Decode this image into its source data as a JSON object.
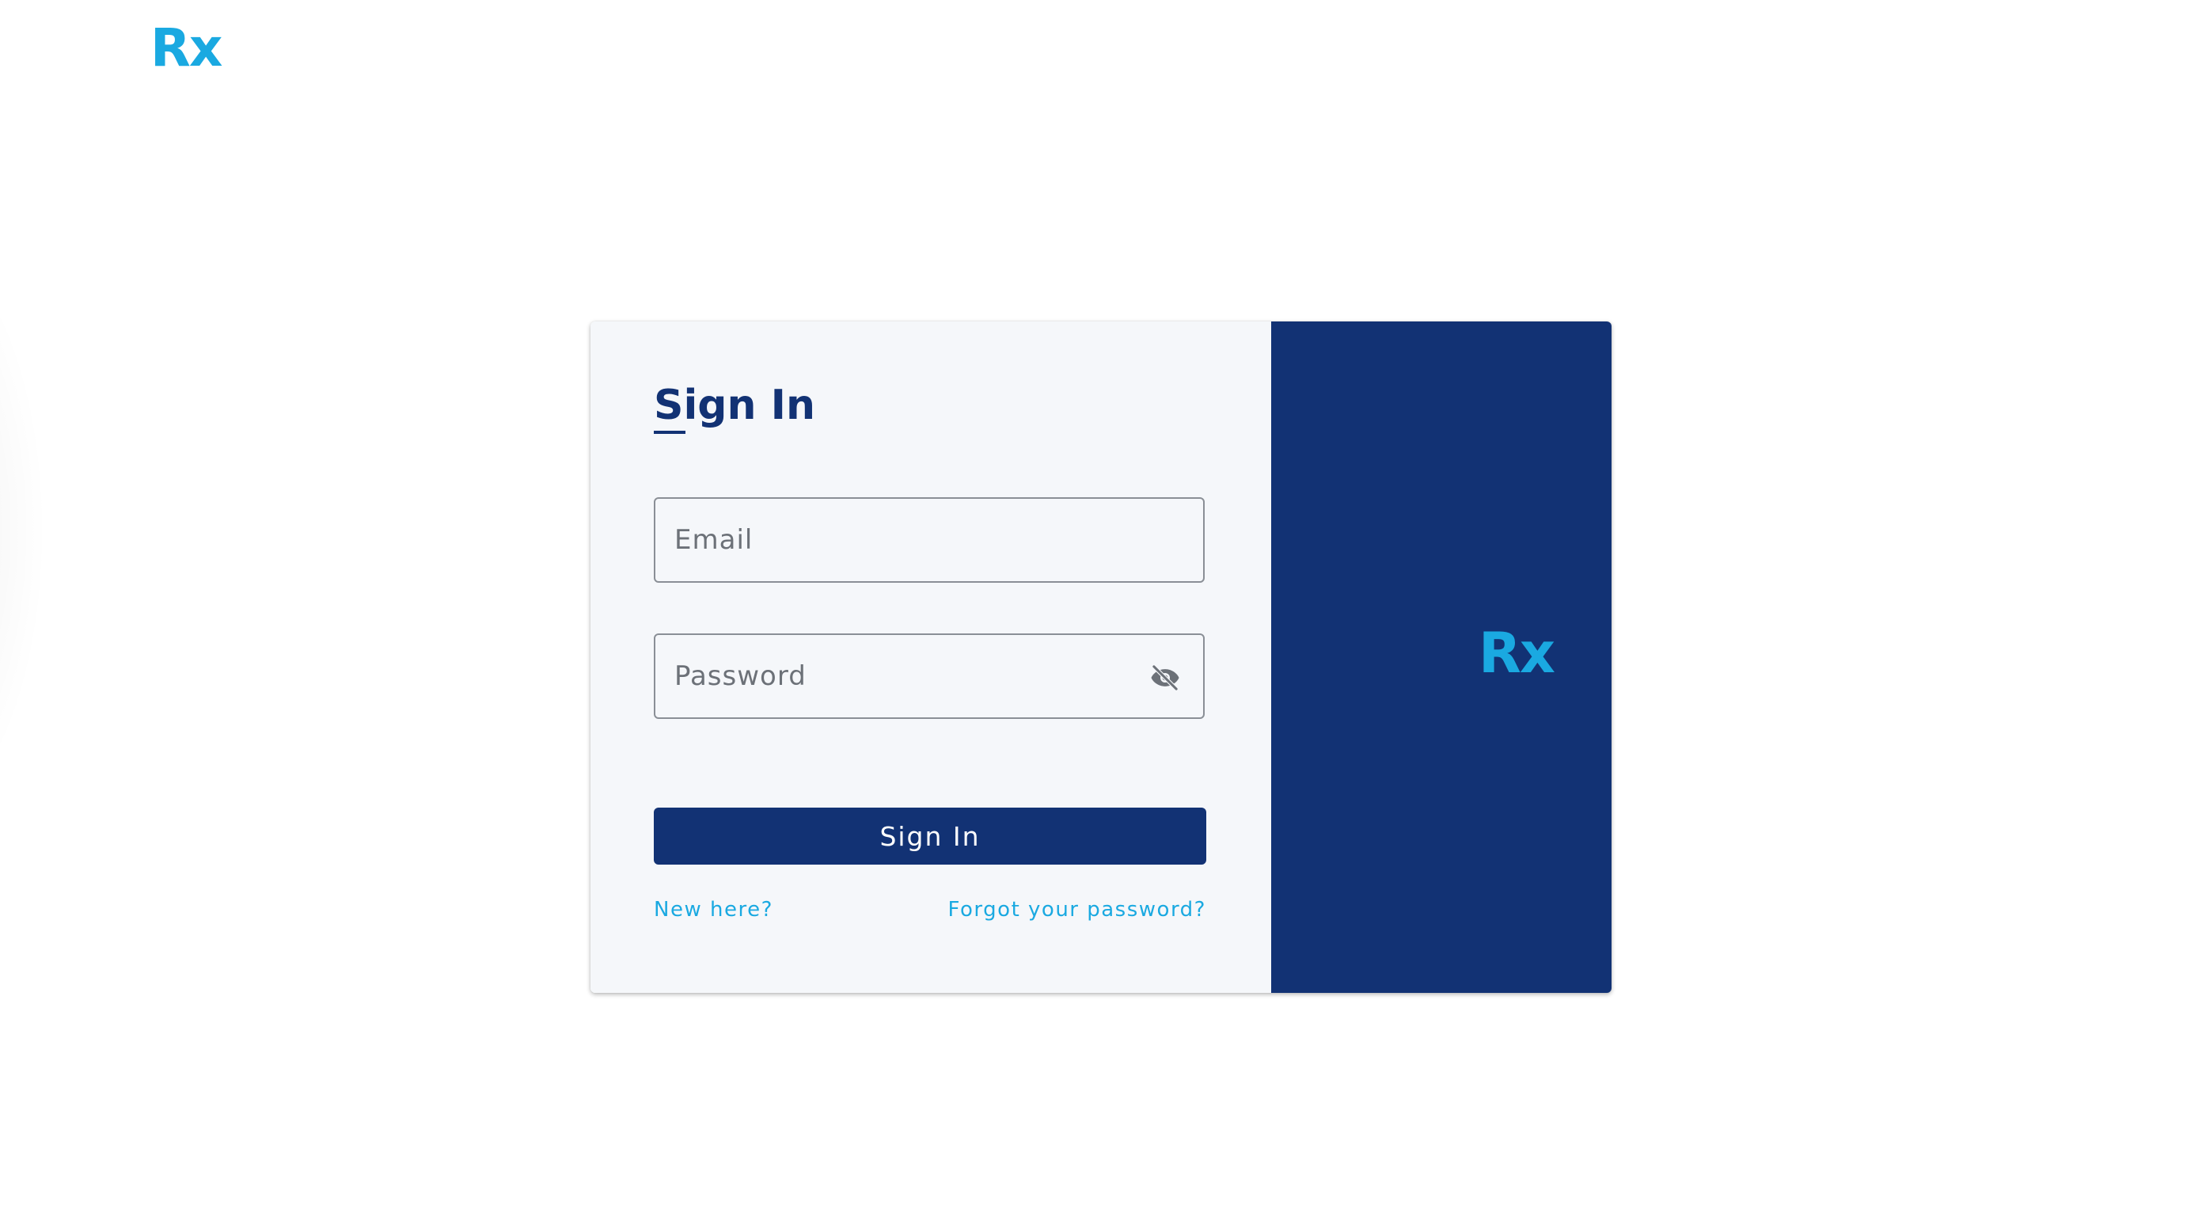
{
  "app": {
    "logo_text": "Rx"
  },
  "sign_in_form": {
    "title": "Sign In",
    "email": {
      "placeholder": "Email",
      "value": ""
    },
    "password": {
      "placeholder": "Password",
      "value": "",
      "toggle_icon": "eye-off-icon"
    },
    "submit_label": "Sign In",
    "new_here_link": "New here?",
    "forgot_password_link": "Forgot your password?"
  },
  "brand_panel": {
    "logo_text": "Rx"
  },
  "colors": {
    "navy": "#123274",
    "accent": "#1aa9e1",
    "form_background": "#f5f7fa",
    "border": "#8a8f96"
  }
}
